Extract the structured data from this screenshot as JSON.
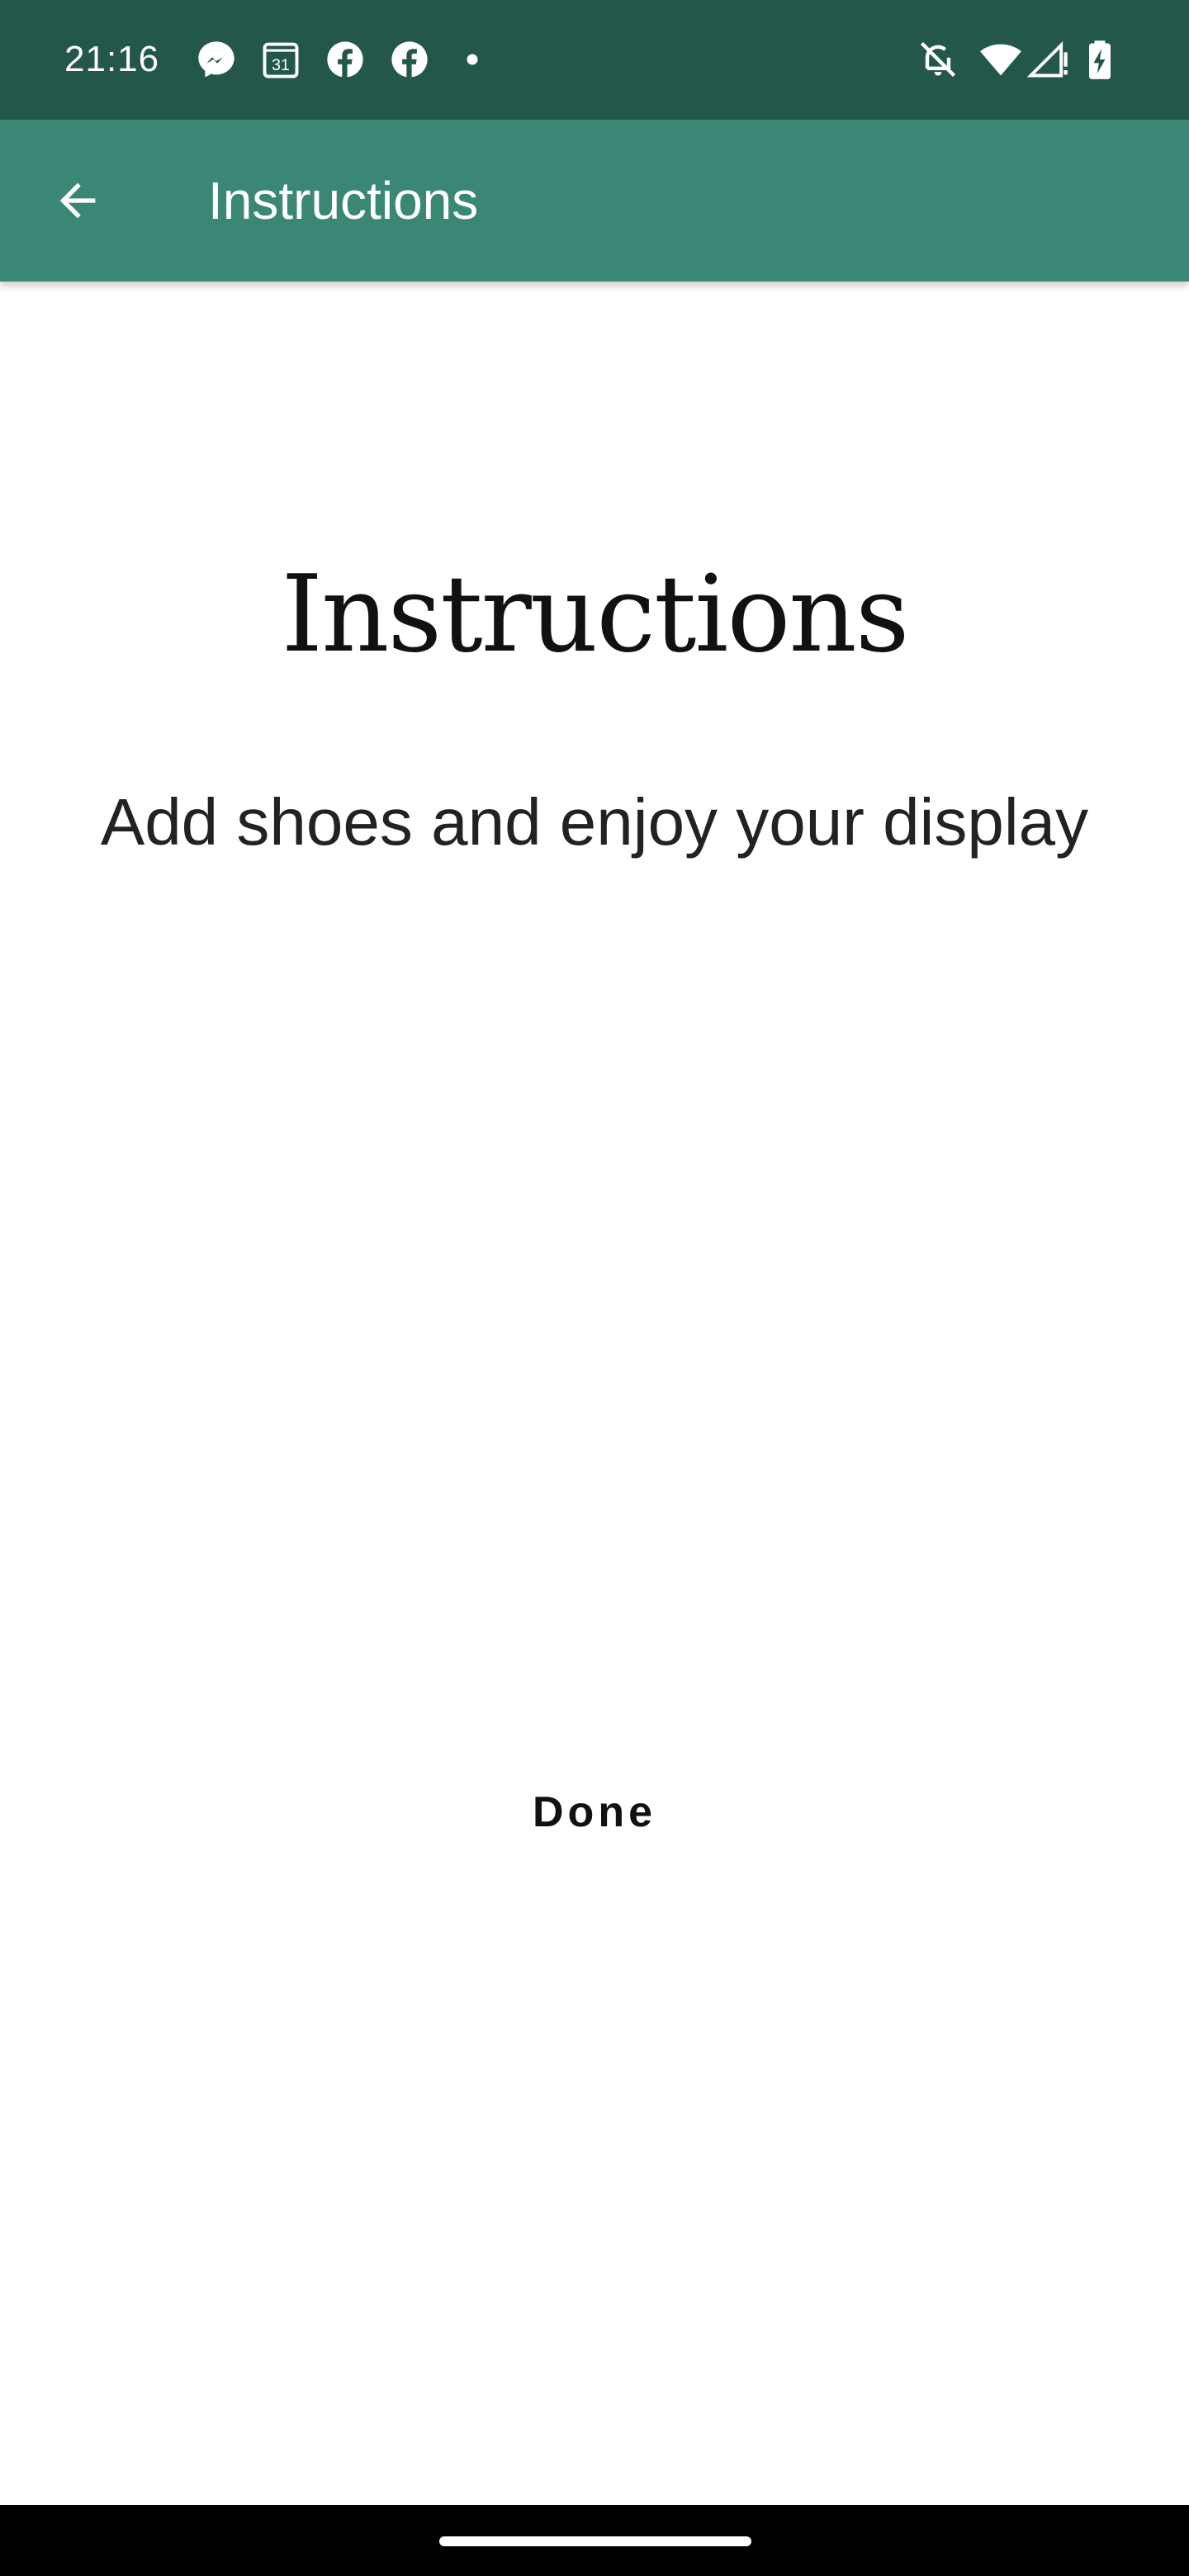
{
  "status_bar": {
    "time": "21:16",
    "calendar_day": "31",
    "notification_icons": [
      "messenger-icon",
      "calendar-icon",
      "facebook-icon",
      "facebook-icon",
      "more-dot-icon"
    ],
    "system_icons": [
      "bell-off-icon",
      "wifi-icon",
      "signal-no-data-icon",
      "battery-charging-icon"
    ],
    "background_color": "#23574a"
  },
  "app_bar": {
    "title": "Instructions",
    "back_icon": "arrow-back-icon",
    "background_color": "#3b8776"
  },
  "content": {
    "heading": "Instructions",
    "subtitle": "Add shoes and enjoy your display"
  },
  "actions": {
    "done_label": "Done"
  }
}
